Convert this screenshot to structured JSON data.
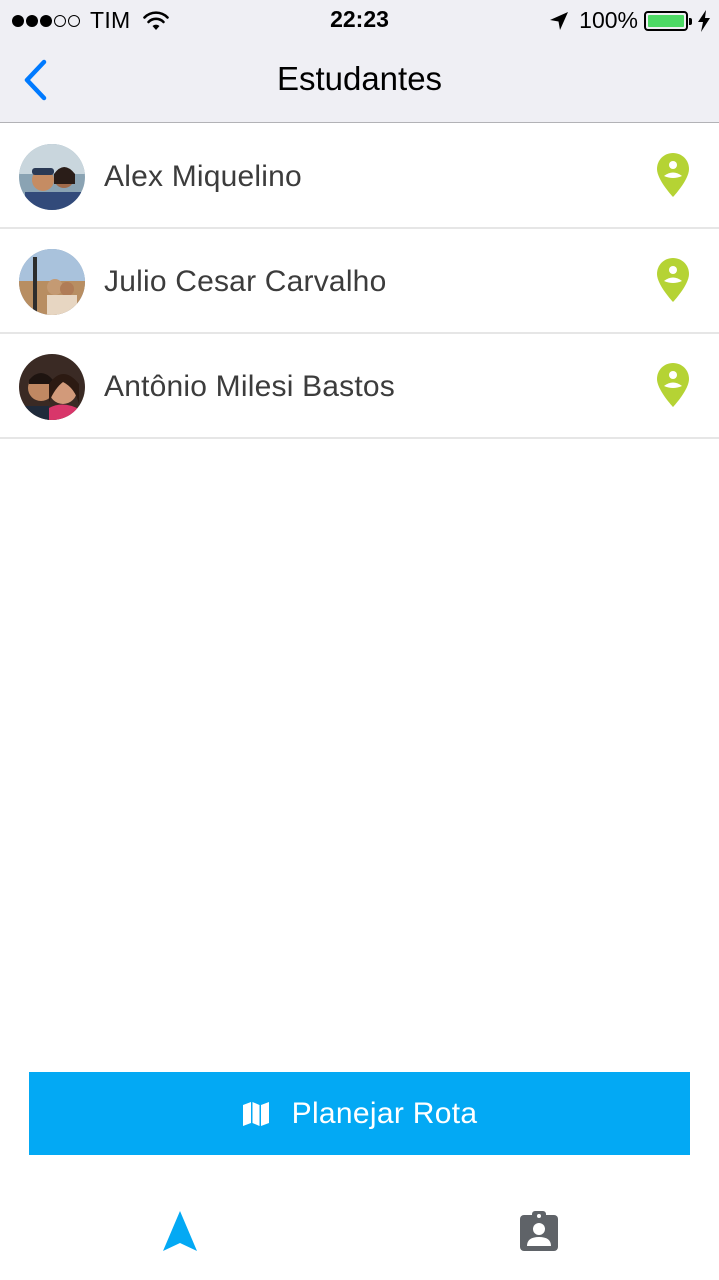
{
  "status_bar": {
    "carrier": "TIM",
    "signal_bars_filled": 3,
    "signal_bars_total": 5,
    "time": "22:23",
    "battery_percent_label": "100%",
    "battery_level": 1.0,
    "icons": [
      "wifi-icon",
      "location-arrow-icon",
      "battery-icon",
      "charging-bolt-icon"
    ]
  },
  "nav": {
    "title": "Estudantes",
    "back_icon": "chevron-left-icon"
  },
  "students": [
    {
      "name": "Alex Miquelino",
      "action_icon": "map-pin-icon"
    },
    {
      "name": "Julio Cesar Carvalho",
      "action_icon": "map-pin-icon"
    },
    {
      "name": "Antônio Milesi Bastos",
      "action_icon": "map-pin-icon"
    }
  ],
  "plan_button": {
    "label": "Planejar Rota",
    "icon": "map-icon"
  },
  "tab_bar": {
    "tabs": [
      {
        "icon": "navigation-arrow-icon",
        "active": true
      },
      {
        "icon": "assignment-ind-icon",
        "active": false
      }
    ]
  },
  "colors": {
    "accent_blue": "#03a9f4",
    "ios_blue": "#007aff",
    "pin_green": "#b5d334",
    "battery_green": "#4cd964",
    "header_bg": "#efeff4",
    "tab_inactive": "#5f6368"
  }
}
